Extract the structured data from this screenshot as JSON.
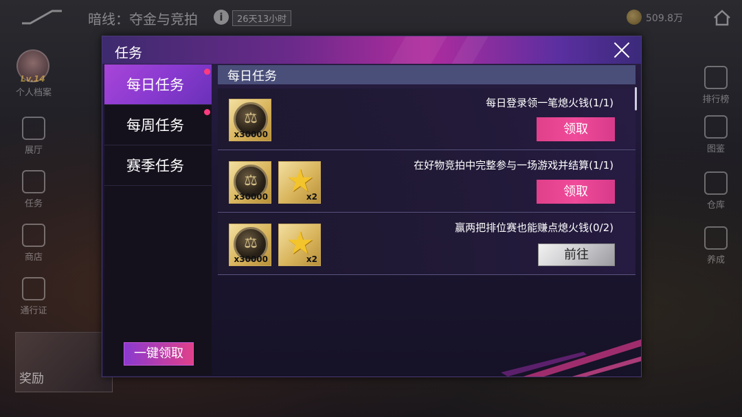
{
  "hud": {
    "event_title": "暗线：夺金与竞拍",
    "time_remaining": "26天13小时",
    "currency_value": "509.8万",
    "profile": {
      "level": "Lv.14",
      "label": "个人档案"
    },
    "left_menu": [
      {
        "label": "展厅",
        "icon": "trophy-icon"
      },
      {
        "label": "任务",
        "icon": "clipboard-icon"
      },
      {
        "label": "商店",
        "icon": "shop-icon"
      },
      {
        "label": "通行证",
        "icon": "pass-icon"
      }
    ],
    "reward_label": "奖励",
    "right_menu": [
      {
        "label": "排行榜",
        "icon": "leaderboard-icon"
      },
      {
        "label": "图鉴",
        "icon": "album-icon"
      },
      {
        "label": "仓库",
        "icon": "warehouse-icon"
      },
      {
        "label": "养成",
        "icon": "growth-icon"
      }
    ]
  },
  "modal": {
    "title": "任务",
    "tabs": [
      {
        "label": "每日任务",
        "active": true,
        "has_dot": true
      },
      {
        "label": "每周任务",
        "active": false,
        "has_dot": true
      },
      {
        "label": "赛季任务",
        "active": false,
        "has_dot": false
      }
    ],
    "claim_all_label": "一键领取",
    "section_title": "每日任务",
    "tasks": [
      {
        "name": "每日登录领一笔熄火钱(1/1)",
        "rewards": [
          {
            "icon": "coin-icon",
            "qty": "x30000"
          }
        ],
        "button": {
          "label": "领取",
          "type": "claim"
        }
      },
      {
        "name": "在好物竞拍中完整参与一场游戏并结算(1/1)",
        "rewards": [
          {
            "icon": "coin-icon",
            "qty": "x30000"
          },
          {
            "icon": "star-icon",
            "qty": "x2"
          }
        ],
        "button": {
          "label": "领取",
          "type": "claim"
        }
      },
      {
        "name": "赢两把排位赛也能赚点熄火钱(0/2)",
        "rewards": [
          {
            "icon": "coin-icon",
            "qty": "x30000"
          },
          {
            "icon": "star-icon",
            "qty": "x2"
          }
        ],
        "button": {
          "label": "前往",
          "type": "goto"
        }
      }
    ]
  },
  "colors": {
    "accent_pink": "#e0408a",
    "tab_active": "#8a3ad0",
    "reward_gold": "#d9b55d",
    "section_header": "#4a4f7a"
  }
}
